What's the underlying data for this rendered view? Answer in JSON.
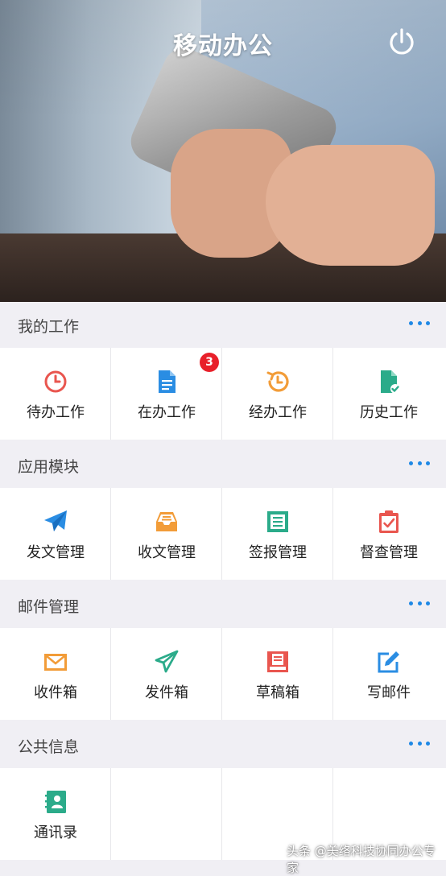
{
  "app": {
    "title": "移动办公"
  },
  "colors": {
    "accent": "#1e88e5",
    "badge": "#e8202a",
    "orange": "#f29c38",
    "red": "#e9564f",
    "green": "#2bab8a",
    "blue": "#2a8de3"
  },
  "sections": [
    {
      "title": "我的工作",
      "items": [
        {
          "label": "待办工作",
          "icon": "clock-icon"
        },
        {
          "label": "在办工作",
          "icon": "document-icon",
          "badge": "3"
        },
        {
          "label": "经办工作",
          "icon": "history-icon"
        },
        {
          "label": "历史工作",
          "icon": "file-check-icon"
        }
      ]
    },
    {
      "title": "应用模块",
      "items": [
        {
          "label": "发文管理",
          "icon": "paper-plane-icon"
        },
        {
          "label": "收文管理",
          "icon": "inbox-tray-icon"
        },
        {
          "label": "签报管理",
          "icon": "list-doc-icon"
        },
        {
          "label": "督查管理",
          "icon": "clipboard-check-icon"
        }
      ]
    },
    {
      "title": "邮件管理",
      "items": [
        {
          "label": "收件箱",
          "icon": "envelope-icon"
        },
        {
          "label": "发件箱",
          "icon": "send-outline-icon"
        },
        {
          "label": "草稿箱",
          "icon": "draft-tray-icon"
        },
        {
          "label": "写邮件",
          "icon": "edit-icon"
        }
      ]
    },
    {
      "title": "公共信息",
      "items": [
        {
          "label": "通讯录",
          "icon": "contacts-book-icon"
        }
      ]
    }
  ],
  "watermark": "头条 @美络科技协同办公专家"
}
